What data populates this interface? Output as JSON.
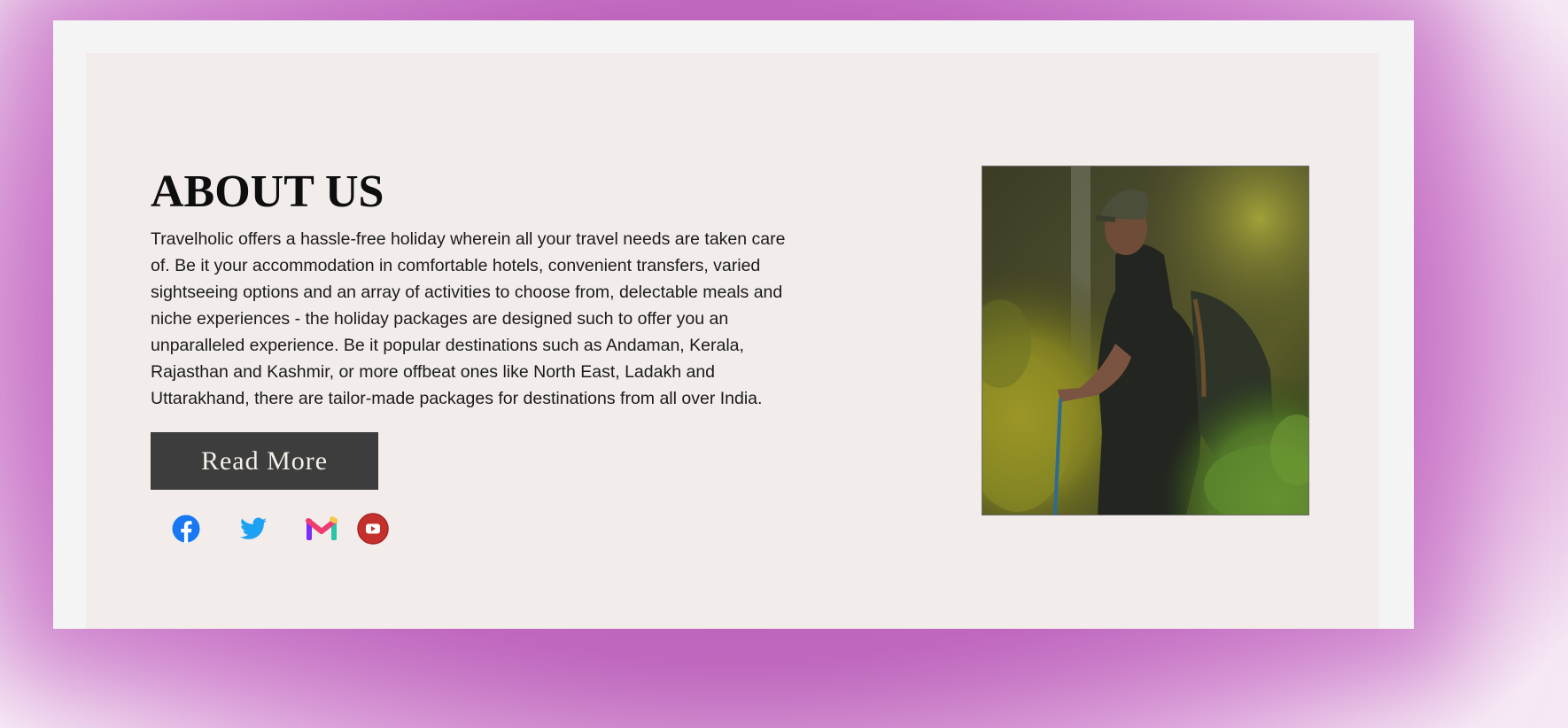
{
  "about": {
    "title": "ABOUT US",
    "description": "Travelholic offers a hassle-free holiday wherein all your travel needs are taken care of. Be it your accommodation in comfortable hotels, convenient transfers, varied sightseeing options and an array of activities to choose from, delectable meals and niche experiences - the holiday packages are designed such to offer you an unparalleled experience. Be it popular destinations such as Andaman, Kerala, Rajasthan and Kashmir, or more offbeat ones like North East, Ladakh and Uttarakhand, there are tailor-made packages for destinations from all over India.",
    "read_more_label": "Read More"
  },
  "social": {
    "icons": [
      "facebook-icon",
      "twitter-icon",
      "gmail-icon",
      "youtube-icon"
    ]
  },
  "photo": {
    "icon": "hiker-photo"
  },
  "colors": {
    "background_accent": "#c16dbf",
    "card": "#f4f4f4",
    "panel": "#f2eceb",
    "button": "#3d3d3d",
    "facebook": "#1877f2",
    "twitter": "#1da1f2",
    "youtube": "#c4302b"
  }
}
